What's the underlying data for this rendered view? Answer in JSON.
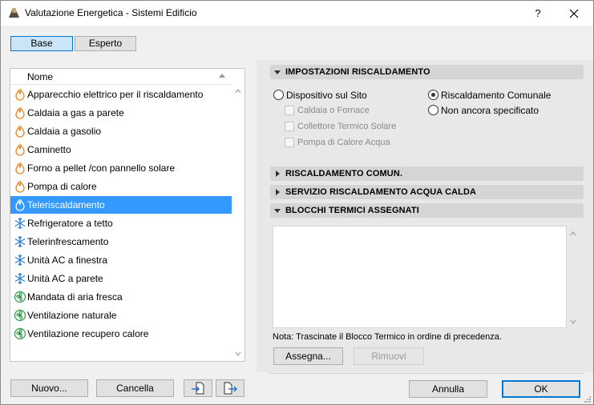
{
  "window": {
    "title": "Valutazione Energetica - Sistemi Edificio",
    "help": "?"
  },
  "mode_tabs": [
    {
      "label": "Base",
      "active": true
    },
    {
      "label": "Esperto",
      "active": false
    }
  ],
  "list": {
    "header": "Nome",
    "items": [
      {
        "label": "Apparecchio elettrico per il riscaldamento",
        "icon": "flame-icon"
      },
      {
        "label": "Caldaia a gas a parete",
        "icon": "flame-icon"
      },
      {
        "label": "Caldaia a gasolio",
        "icon": "flame-icon"
      },
      {
        "label": "Caminetto",
        "icon": "flame-icon"
      },
      {
        "label": "Forno a pellet /con pannello solare",
        "icon": "flame-icon"
      },
      {
        "label": "Pompa di calore",
        "icon": "flame-icon"
      },
      {
        "label": "Teleriscaldamento",
        "icon": "flame-icon",
        "selected": true
      },
      {
        "label": "Refrigeratore a tetto",
        "icon": "snowflake-icon"
      },
      {
        "label": "Telerinfrescamento",
        "icon": "snowflake-icon"
      },
      {
        "label": "Unità AC a finestra",
        "icon": "snowflake-icon"
      },
      {
        "label": "Unità AC a parete",
        "icon": "snowflake-icon"
      },
      {
        "label": "Mandata di aria fresca",
        "icon": "fan-icon"
      },
      {
        "label": "Ventilazione naturale",
        "icon": "fan-icon"
      },
      {
        "label": "Ventilazione recupero calore",
        "icon": "fan-icon"
      }
    ]
  },
  "list_buttons": {
    "new_label": "Nuovo...",
    "delete_label": "Cancella",
    "import_icon": "import-icon",
    "export_icon": "export-icon"
  },
  "sections": {
    "heating_settings": "IMPOSTAZIONI RISCALDAMENTO",
    "district_heating": "RISCALDAMENTO COMUN.",
    "hot_water": "SERVIZIO RISCALDAMENTO ACQUA CALDA",
    "thermal_blocks": "BLOCCHI TERMICI ASSEGNATI"
  },
  "heating": {
    "on_site": "Dispositivo sul Sito",
    "district": "Riscaldamento Comunale",
    "not_specified": "Non ancora specificato",
    "selected": "district",
    "boiler": "Caldaia o Fornace",
    "solar_collector": "Collettore Termico Solare",
    "water_heat_pump": "Pompa di Calore Acqua"
  },
  "blocks": {
    "note": "Nota: Trascinate il Blocco Termico in ordine di precedenza.",
    "assign_label": "Assegna...",
    "remove_label": "Rimuovi"
  },
  "footer": {
    "cancel_label": "Annulla",
    "ok_label": "OK"
  },
  "colors": {
    "selection": "#3399ff",
    "flame": "#e8861a",
    "snow": "#2a7fd4",
    "fan": "#2f9a47",
    "ok_border": "#0078d7"
  }
}
